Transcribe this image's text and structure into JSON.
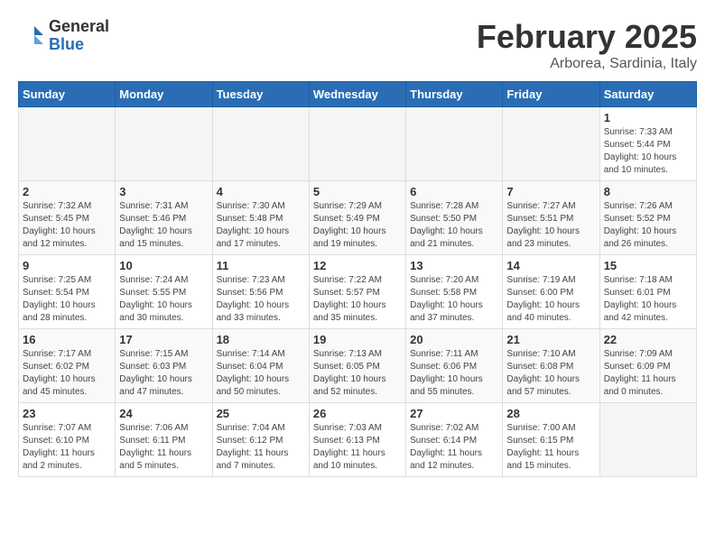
{
  "logo": {
    "general": "General",
    "blue": "Blue"
  },
  "title": {
    "month_year": "February 2025",
    "location": "Arborea, Sardinia, Italy"
  },
  "days_of_week": [
    "Sunday",
    "Monday",
    "Tuesday",
    "Wednesday",
    "Thursday",
    "Friday",
    "Saturday"
  ],
  "weeks": [
    [
      {
        "day": "",
        "info": ""
      },
      {
        "day": "",
        "info": ""
      },
      {
        "day": "",
        "info": ""
      },
      {
        "day": "",
        "info": ""
      },
      {
        "day": "",
        "info": ""
      },
      {
        "day": "",
        "info": ""
      },
      {
        "day": "1",
        "info": "Sunrise: 7:33 AM\nSunset: 5:44 PM\nDaylight: 10 hours\nand 10 minutes."
      }
    ],
    [
      {
        "day": "2",
        "info": "Sunrise: 7:32 AM\nSunset: 5:45 PM\nDaylight: 10 hours\nand 12 minutes."
      },
      {
        "day": "3",
        "info": "Sunrise: 7:31 AM\nSunset: 5:46 PM\nDaylight: 10 hours\nand 15 minutes."
      },
      {
        "day": "4",
        "info": "Sunrise: 7:30 AM\nSunset: 5:48 PM\nDaylight: 10 hours\nand 17 minutes."
      },
      {
        "day": "5",
        "info": "Sunrise: 7:29 AM\nSunset: 5:49 PM\nDaylight: 10 hours\nand 19 minutes."
      },
      {
        "day": "6",
        "info": "Sunrise: 7:28 AM\nSunset: 5:50 PM\nDaylight: 10 hours\nand 21 minutes."
      },
      {
        "day": "7",
        "info": "Sunrise: 7:27 AM\nSunset: 5:51 PM\nDaylight: 10 hours\nand 23 minutes."
      },
      {
        "day": "8",
        "info": "Sunrise: 7:26 AM\nSunset: 5:52 PM\nDaylight: 10 hours\nand 26 minutes."
      }
    ],
    [
      {
        "day": "9",
        "info": "Sunrise: 7:25 AM\nSunset: 5:54 PM\nDaylight: 10 hours\nand 28 minutes."
      },
      {
        "day": "10",
        "info": "Sunrise: 7:24 AM\nSunset: 5:55 PM\nDaylight: 10 hours\nand 30 minutes."
      },
      {
        "day": "11",
        "info": "Sunrise: 7:23 AM\nSunset: 5:56 PM\nDaylight: 10 hours\nand 33 minutes."
      },
      {
        "day": "12",
        "info": "Sunrise: 7:22 AM\nSunset: 5:57 PM\nDaylight: 10 hours\nand 35 minutes."
      },
      {
        "day": "13",
        "info": "Sunrise: 7:20 AM\nSunset: 5:58 PM\nDaylight: 10 hours\nand 37 minutes."
      },
      {
        "day": "14",
        "info": "Sunrise: 7:19 AM\nSunset: 6:00 PM\nDaylight: 10 hours\nand 40 minutes."
      },
      {
        "day": "15",
        "info": "Sunrise: 7:18 AM\nSunset: 6:01 PM\nDaylight: 10 hours\nand 42 minutes."
      }
    ],
    [
      {
        "day": "16",
        "info": "Sunrise: 7:17 AM\nSunset: 6:02 PM\nDaylight: 10 hours\nand 45 minutes."
      },
      {
        "day": "17",
        "info": "Sunrise: 7:15 AM\nSunset: 6:03 PM\nDaylight: 10 hours\nand 47 minutes."
      },
      {
        "day": "18",
        "info": "Sunrise: 7:14 AM\nSunset: 6:04 PM\nDaylight: 10 hours\nand 50 minutes."
      },
      {
        "day": "19",
        "info": "Sunrise: 7:13 AM\nSunset: 6:05 PM\nDaylight: 10 hours\nand 52 minutes."
      },
      {
        "day": "20",
        "info": "Sunrise: 7:11 AM\nSunset: 6:06 PM\nDaylight: 10 hours\nand 55 minutes."
      },
      {
        "day": "21",
        "info": "Sunrise: 7:10 AM\nSunset: 6:08 PM\nDaylight: 10 hours\nand 57 minutes."
      },
      {
        "day": "22",
        "info": "Sunrise: 7:09 AM\nSunset: 6:09 PM\nDaylight: 11 hours\nand 0 minutes."
      }
    ],
    [
      {
        "day": "23",
        "info": "Sunrise: 7:07 AM\nSunset: 6:10 PM\nDaylight: 11 hours\nand 2 minutes."
      },
      {
        "day": "24",
        "info": "Sunrise: 7:06 AM\nSunset: 6:11 PM\nDaylight: 11 hours\nand 5 minutes."
      },
      {
        "day": "25",
        "info": "Sunrise: 7:04 AM\nSunset: 6:12 PM\nDaylight: 11 hours\nand 7 minutes."
      },
      {
        "day": "26",
        "info": "Sunrise: 7:03 AM\nSunset: 6:13 PM\nDaylight: 11 hours\nand 10 minutes."
      },
      {
        "day": "27",
        "info": "Sunrise: 7:02 AM\nSunset: 6:14 PM\nDaylight: 11 hours\nand 12 minutes."
      },
      {
        "day": "28",
        "info": "Sunrise: 7:00 AM\nSunset: 6:15 PM\nDaylight: 11 hours\nand 15 minutes."
      },
      {
        "day": "",
        "info": ""
      }
    ]
  ]
}
